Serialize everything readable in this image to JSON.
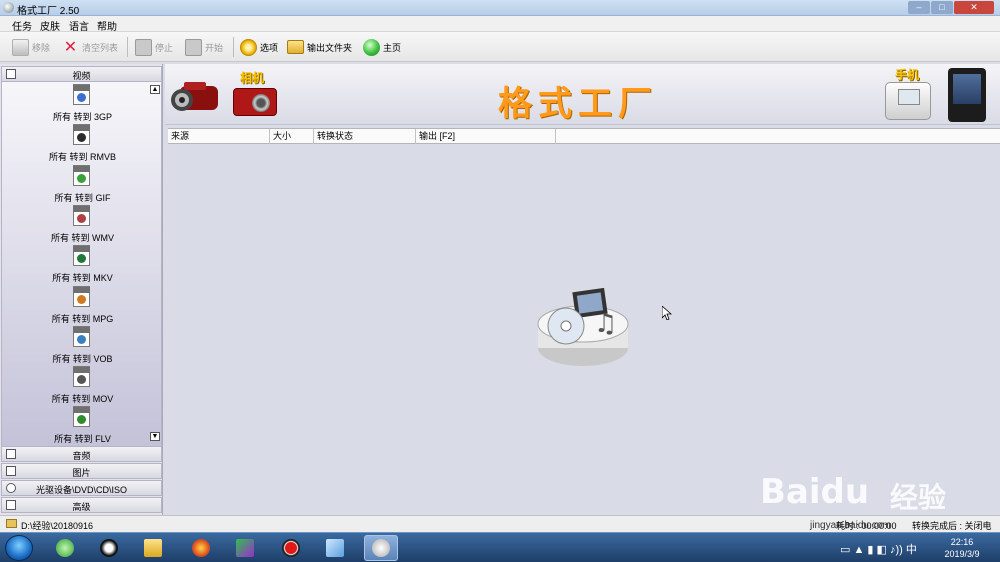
{
  "window": {
    "title": "格式工厂 2.50"
  },
  "menu": [
    "任务",
    "皮肤",
    "语言",
    "帮助"
  ],
  "toolbar": {
    "remove": "移除",
    "clear_list": "清空列表",
    "stop": "停止",
    "start": "开始",
    "options": "选项",
    "output_folder": "输出文件夹",
    "home": "主页"
  },
  "sidebar": {
    "sections": {
      "video": "视频",
      "audio": "音频",
      "picture": "图片",
      "rom": "光驱设备\\DVD\\CD\\ISO",
      "advanced": "高级"
    },
    "video_items": [
      {
        "tag": "3GP",
        "label": "所有 转到 3GP"
      },
      {
        "tag": "RMVB",
        "label": "所有 转到 RMVB"
      },
      {
        "tag": "GIF",
        "label": "所有 转到 GIF"
      },
      {
        "tag": "WMV",
        "label": "所有 转到 WMV"
      },
      {
        "tag": "MKV",
        "label": "所有 转到 MKV"
      },
      {
        "tag": "MPG",
        "label": "所有 转到 MPG"
      },
      {
        "tag": "VOB",
        "label": "所有 转到 VOB"
      },
      {
        "tag": "MOV",
        "label": "所有 转到 MOV"
      },
      {
        "tag": "FLV",
        "label": "所有 转到 FLV"
      }
    ]
  },
  "banner": {
    "logo": "格式工厂",
    "camera_label": "相机",
    "phone_label": "手机"
  },
  "file_list": {
    "columns": [
      "来源",
      "大小",
      "转换状态",
      "输出 [F2]"
    ]
  },
  "status": {
    "output_path": "D:\\经验\\20180916",
    "elapsed": "耗时 : 00:00:00",
    "after_convert": "转换完成后 : 关闭电脑"
  },
  "taskbar": {
    "time": "22:16",
    "date": "2019/3/9"
  },
  "watermark": {
    "brand": "Baidu",
    "product": "经验",
    "site": "jingyan.baidu.com"
  },
  "colors": {
    "logo_orange": "#ff9a1a",
    "label_yellow": "#f7c400",
    "taskbar_blue": "#1e3e68"
  }
}
